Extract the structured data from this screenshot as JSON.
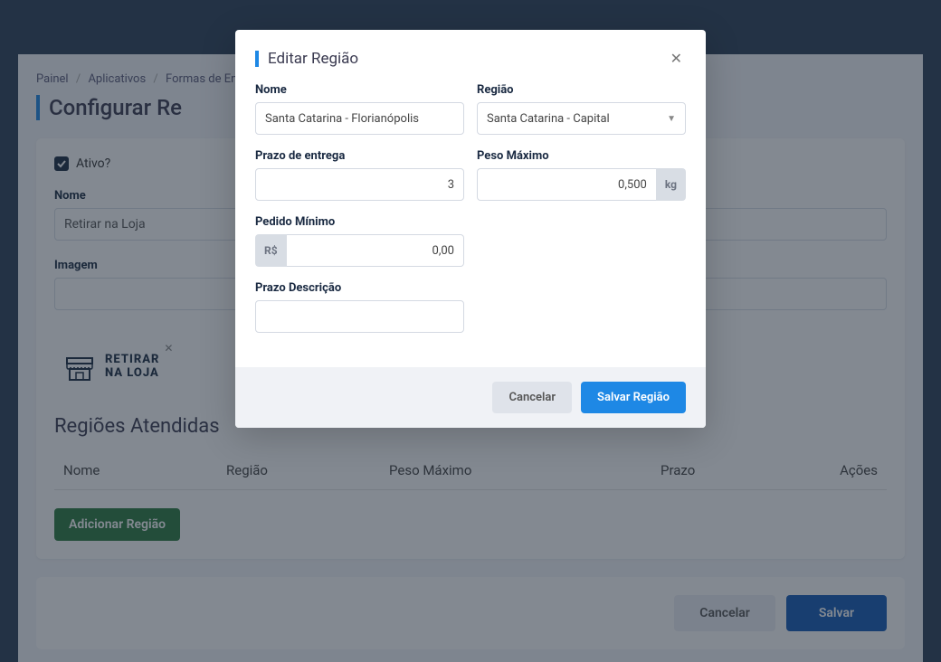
{
  "breadcrumb": {
    "item1": "Painel",
    "item2": "Aplicativos",
    "item3": "Formas de En"
  },
  "page": {
    "title": "Configurar Re"
  },
  "checkbox": {
    "label": "Ativo?"
  },
  "fields": {
    "nome_label": "Nome",
    "nome_value": "Retirar na Loja",
    "imagem_label": "Imagem"
  },
  "preview": {
    "line1": "RETIRAR",
    "line2": "NA LOJA"
  },
  "section": {
    "title": "Regiões Atendidas"
  },
  "table": {
    "col_nome": "Nome",
    "col_regiao": "Região",
    "col_peso": "Peso Máximo",
    "col_prazo": "Prazo",
    "col_acoes": "Ações"
  },
  "buttons": {
    "add_region": "Adicionar Região",
    "cancel": "Cancelar",
    "save": "Salvar"
  },
  "modal": {
    "title": "Editar Região",
    "nome_label": "Nome",
    "nome_value": "Santa Catarina - Florianópolis",
    "regiao_label": "Região",
    "regiao_value": "Santa Catarina - Capital",
    "prazo_label": "Prazo de entrega",
    "prazo_value": "3",
    "peso_label": "Peso Máximo",
    "peso_value": "0,500",
    "peso_unit": "kg",
    "pedido_label": "Pedido Mínimo",
    "pedido_prefix": "R$",
    "pedido_value": "0,00",
    "descricao_label": "Prazo Descrição",
    "descricao_value": "",
    "cancel": "Cancelar",
    "save": "Salvar Região"
  }
}
